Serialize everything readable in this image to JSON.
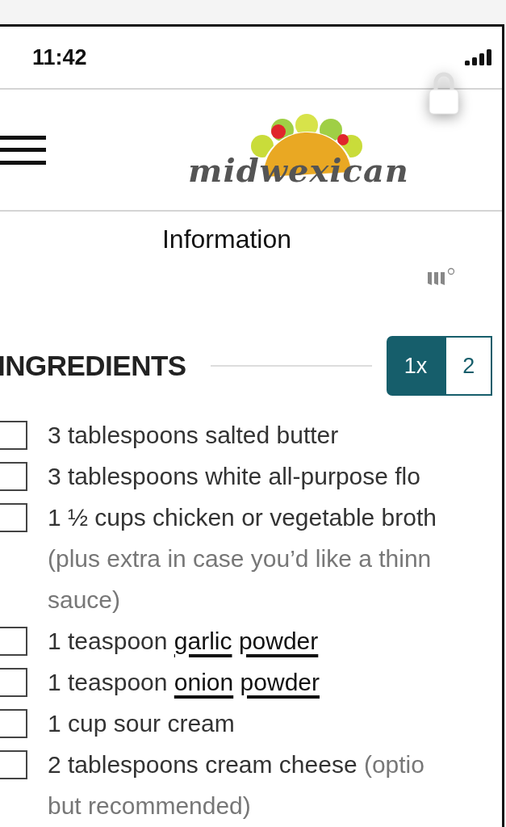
{
  "status_bar": {
    "time": "11:42"
  },
  "header": {
    "logo_text": "midwexican"
  },
  "info_link": {
    "text": "Information"
  },
  "ingredients": {
    "title": "INGREDIENTS",
    "servings": [
      {
        "label": "1x",
        "selected": true
      },
      {
        "label": "2",
        "selected": false
      }
    ],
    "items": [
      {
        "checked": false,
        "parts": [
          {
            "text": "3 tablespoons salted butter"
          }
        ]
      },
      {
        "checked": false,
        "parts": [
          {
            "text": "3 tablespoons white all-purpose flo"
          }
        ]
      },
      {
        "checked": false,
        "parts": [
          {
            "text": "1 ½ cups chicken or vegetable broth"
          }
        ],
        "note_lines": [
          "(plus extra in case you’d like a thinn",
          "sauce)"
        ]
      },
      {
        "checked": false,
        "parts": [
          {
            "text": "1 teaspoon "
          },
          {
            "text": "garlic",
            "kind": "link"
          },
          {
            "text": "powder",
            "kind": "link"
          }
        ]
      },
      {
        "checked": false,
        "parts": [
          {
            "text": "1 teaspoon "
          },
          {
            "text": "onion",
            "kind": "link"
          },
          {
            "text": "powder",
            "kind": "link"
          }
        ]
      },
      {
        "checked": false,
        "parts": [
          {
            "text": "1 cup sour cream"
          }
        ]
      },
      {
        "checked": false,
        "parts": [
          {
            "text": "2 tablespoons cream cheese "
          },
          {
            "text": "(optio",
            "kind": "note"
          }
        ],
        "note_lines": [
          "but recommended)"
        ]
      }
    ]
  }
}
